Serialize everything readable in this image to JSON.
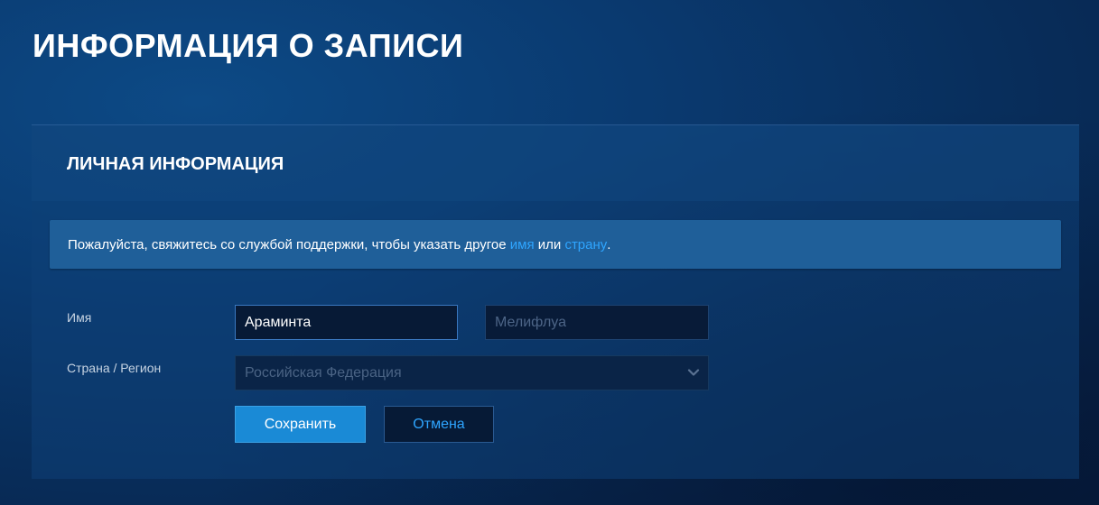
{
  "page": {
    "title": "ИНФОРМАЦИЯ О ЗАПИСИ"
  },
  "section": {
    "title": "ЛИЧНАЯ ИНФОРМАЦИЯ"
  },
  "notice": {
    "text_before": "Пожалуйста, свяжитесь со службой поддержки, чтобы указать другое ",
    "link_name": "имя",
    "text_middle": " или ",
    "link_country": "страну",
    "text_after": "."
  },
  "form": {
    "name_label": "Имя",
    "first_name_value": "Араминта",
    "last_name_placeholder": "Мелифлуа",
    "country_label": "Страна / Регион",
    "country_value": "Российская Федерация",
    "country_icon": "chevron-down-icon"
  },
  "buttons": {
    "save_label": "Сохранить",
    "cancel_label": "Отмена"
  },
  "colors": {
    "accent": "#1a8ad6",
    "link": "#2ea5ff",
    "notice_bg": "#1f5f99"
  }
}
